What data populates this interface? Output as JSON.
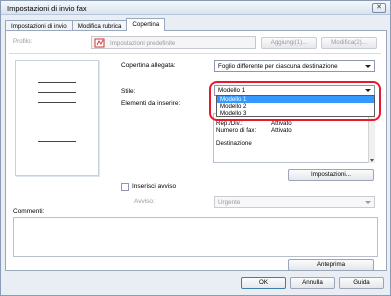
{
  "window": {
    "title": "Impostazioni di invio fax",
    "close_glyph": "✕"
  },
  "tabs": [
    {
      "label": "Impostazioni di invio"
    },
    {
      "label": "Modifica rubrica"
    },
    {
      "label": "Copertina"
    }
  ],
  "profile": {
    "label": "Profilo:",
    "value": "Impostazioni predefinite",
    "add_button": "Aggiungi(1)...",
    "edit_button": "Modifica(2)..."
  },
  "cover": {
    "attached_label": "Copertina allegata:",
    "attached_value": "Foglio differente per ciascuna destinazione",
    "style_label": "Stile:",
    "style_value": "Modello 1",
    "style_options": [
      "Modello 1",
      "Modello 2",
      "Modello 3"
    ],
    "elements_label": "Elementi da inserire:",
    "elements": [
      {
        "key": "Rep./Div.:",
        "value": "Attivato"
      },
      {
        "key": "Numero di fax:",
        "value": "Attivato"
      }
    ],
    "destination_label": "Destinazione",
    "settings_button": "Impostazioni..."
  },
  "send_notice": {
    "checkbox_label": "Inserisci avviso",
    "notice_label": "Avviso:",
    "notice_value": "Urgente"
  },
  "comments": {
    "label": "Commenti:"
  },
  "buttons": {
    "preview": "Anteprima",
    "ok": "OK",
    "cancel": "Annulla",
    "help": "Guida"
  }
}
